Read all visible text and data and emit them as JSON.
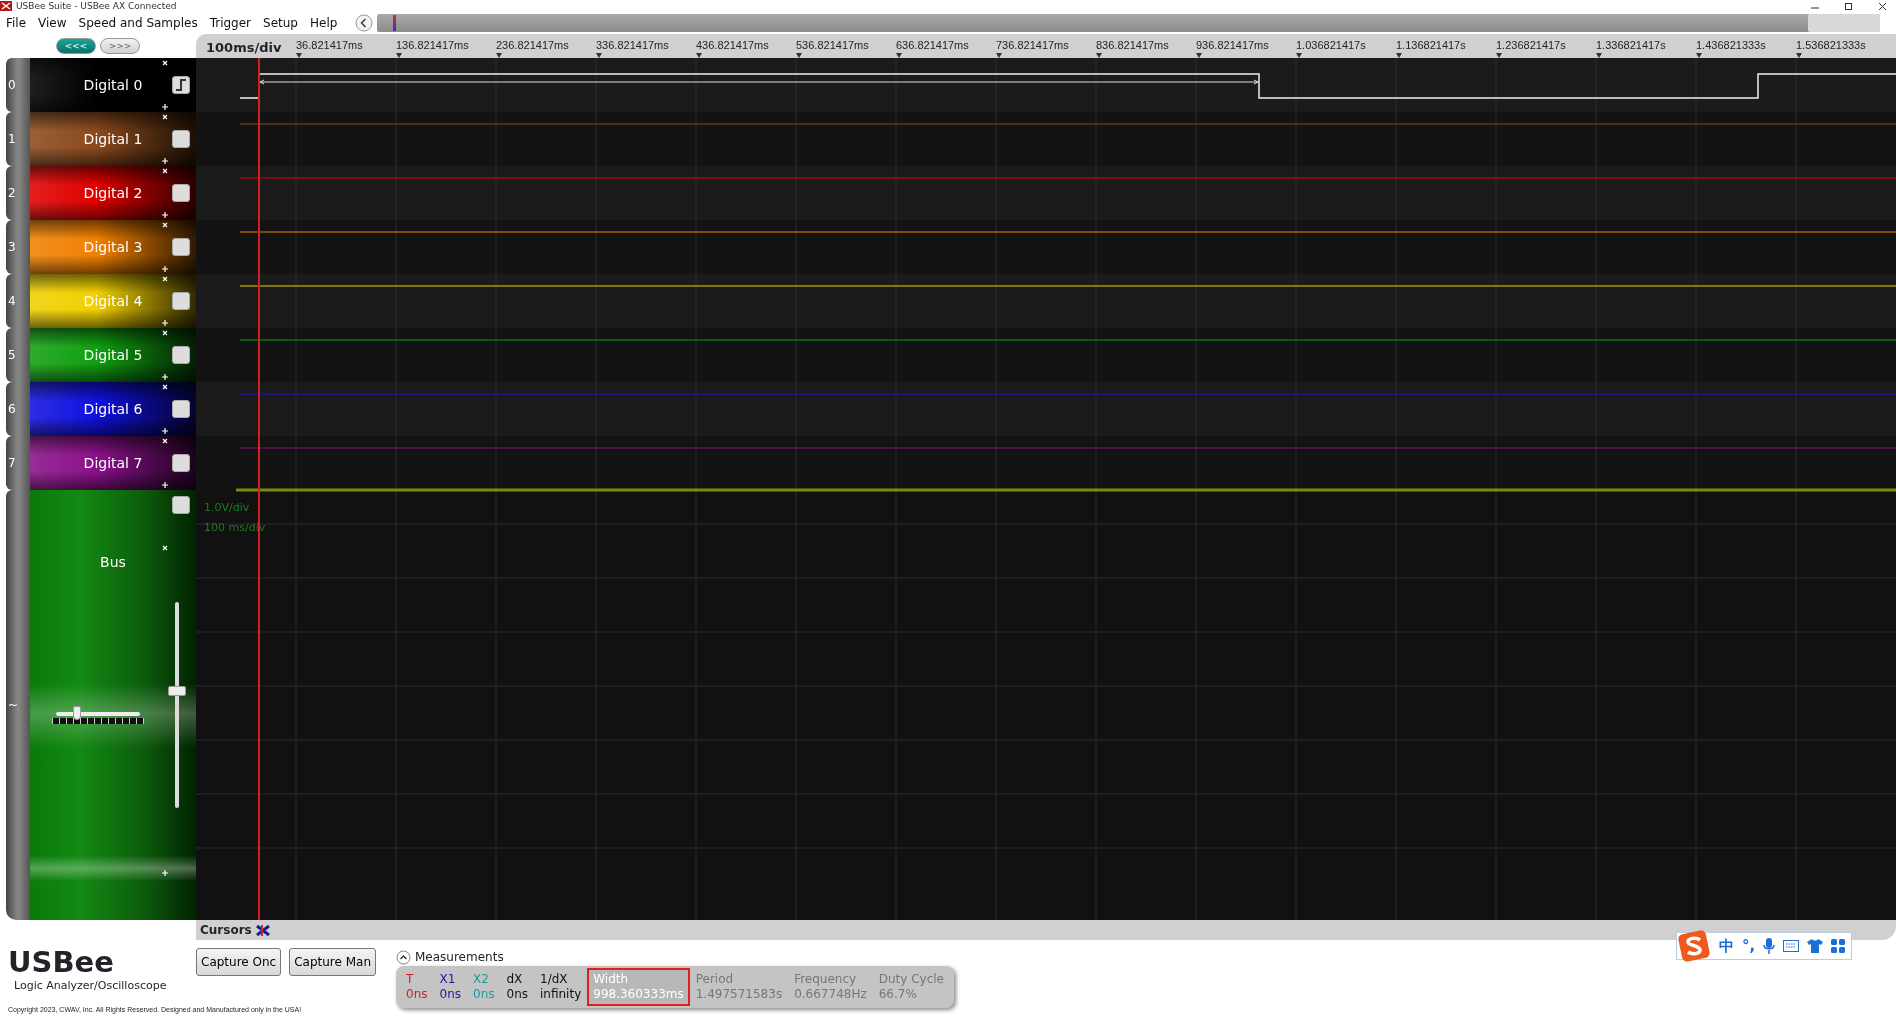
{
  "window": {
    "title": "USBee Suite - USBee AX Connected"
  },
  "menu": [
    "File",
    "View",
    "Speed and Samples",
    "Trigger",
    "Setup",
    "Help"
  ],
  "nav_buttons": [
    {
      "label": "<<<",
      "enabled": true
    },
    {
      "label": ">>>",
      "enabled": false
    }
  ],
  "timebase": "100ms/div",
  "time_ticks": [
    "36.821417ms",
    "136.821417ms",
    "236.821417ms",
    "336.821417ms",
    "436.821417ms",
    "536.821417ms",
    "636.821417ms",
    "736.821417ms",
    "836.821417ms",
    "936.821417ms",
    "1.036821417s",
    "1.136821417s",
    "1.236821417s",
    "1.336821417s",
    "1.436821333s",
    "1.536821333s"
  ],
  "channels": [
    {
      "number": "0",
      "name": "Digital 0",
      "color": "#000000",
      "edge_trigger": true
    },
    {
      "number": "1",
      "name": "Digital 1",
      "color": "#8b4a1c",
      "edge_trigger": false
    },
    {
      "number": "2",
      "name": "Digital 2",
      "color": "#e00000",
      "edge_trigger": false
    },
    {
      "number": "3",
      "name": "Digital 3",
      "color": "#f08000",
      "edge_trigger": false
    },
    {
      "number": "4",
      "name": "Digital 4",
      "color": "#f0d000",
      "edge_trigger": false
    },
    {
      "number": "5",
      "name": "Digital 5",
      "color": "#10a010",
      "edge_trigger": false
    },
    {
      "number": "6",
      "name": "Digital 6",
      "color": "#1010e0",
      "edge_trigger": false
    },
    {
      "number": "7",
      "name": "Digital 7",
      "color": "#8a108a",
      "edge_trigger": false
    }
  ],
  "bus": {
    "number": "~",
    "name": "Bus",
    "checked": false,
    "vertical_slider": {
      "level": 0.57
    },
    "horizontal_slider": {
      "level": 0.25
    }
  },
  "scope_labels": [
    "1.0V/div",
    "100 ms/div"
  ],
  "cursors_bar": {
    "title": "Cursors"
  },
  "brand": {
    "name": "USBee",
    "subtitle": "Logic Analyzer/Oscilloscope",
    "copyright": "Copyright 2023, CWAV, Inc. All Rights Reserved. Designed and Manufactured only in the USA!"
  },
  "capture_buttons": [
    "Capture Onc",
    "Capture Man"
  ],
  "measurements": {
    "title": "Measurements",
    "expanded": true,
    "items": [
      {
        "label": "T",
        "value": "0ns",
        "color": "#c0262b",
        "selected": false
      },
      {
        "label": "X1",
        "value": "0ns",
        "color": "#1a1aa0",
        "selected": false
      },
      {
        "label": "X2",
        "value": "0ns",
        "color": "#1b9c9c",
        "selected": false
      },
      {
        "label": "dX",
        "value": "0ns",
        "color": "#111111",
        "selected": false
      },
      {
        "label": "1/dX",
        "value": "infinity",
        "color": "#111111",
        "selected": false
      },
      {
        "label": "Width",
        "value": "998.360333ms",
        "color": "#ffffff",
        "selected": true
      },
      {
        "label": "Period",
        "value": "1.497571583s",
        "color": "#777777",
        "selected": false
      },
      {
        "label": "Frequency",
        "value": "0.667748Hz",
        "color": "#777777",
        "selected": false
      },
      {
        "label": "Duty Cycle",
        "value": "66.7%",
        "color": "#777777",
        "selected": false
      }
    ]
  },
  "ime_toolbar": {
    "items": [
      "中",
      "°,"
    ]
  }
}
